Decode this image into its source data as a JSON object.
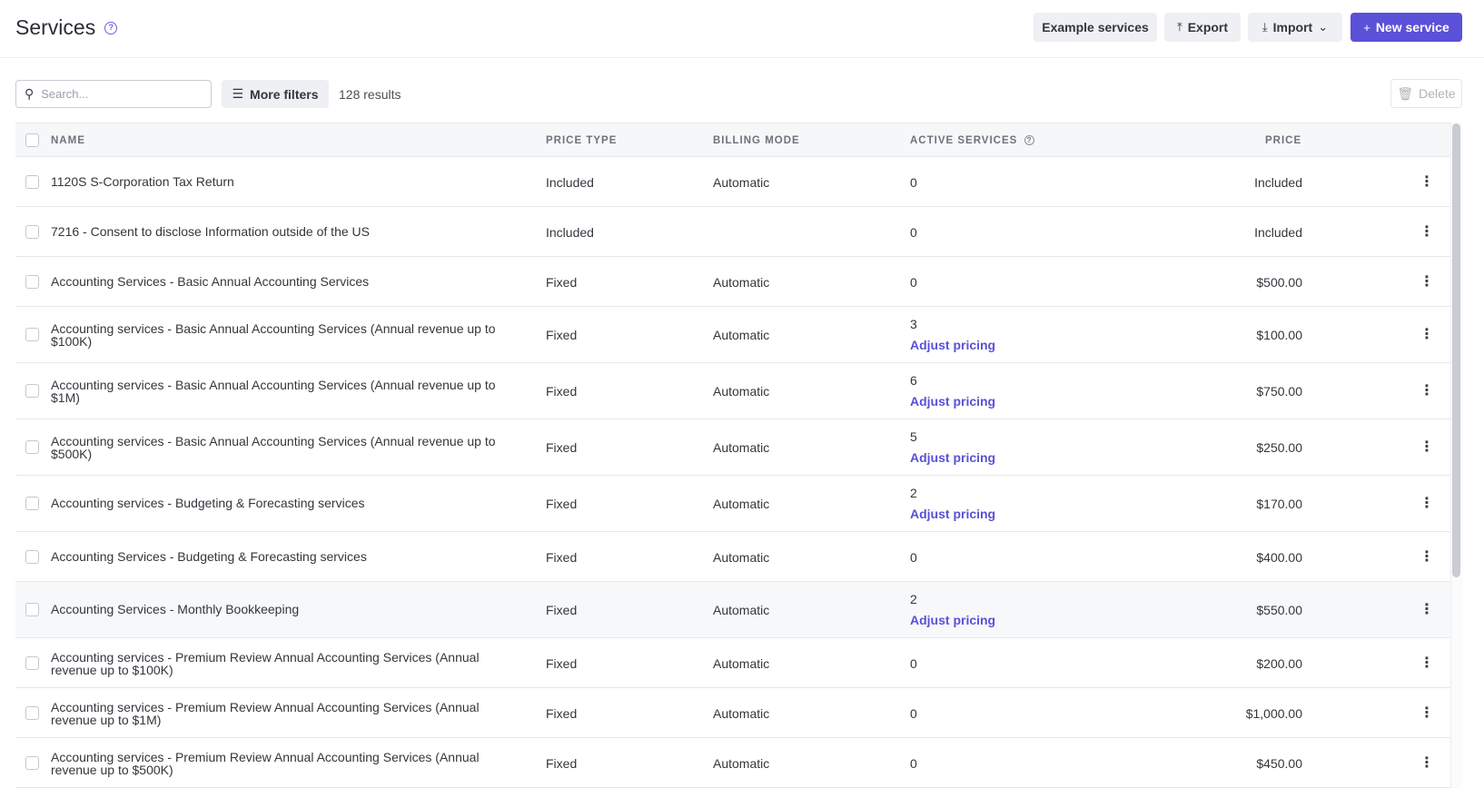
{
  "header": {
    "title": "Services",
    "buttons": {
      "example": "Example services",
      "export": "Export",
      "import": "Import",
      "new_service": "New service"
    }
  },
  "toolbar": {
    "search_placeholder": "Search...",
    "more_filters": "More filters",
    "results": "128 results",
    "delete": "Delete"
  },
  "columns": {
    "name": "NAME",
    "price_type": "PRICE TYPE",
    "billing_mode": "BILLING MODE",
    "active_services": "ACTIVE SERVICES",
    "price": "PRICE"
  },
  "adjust_label": "Adjust pricing",
  "rows": [
    {
      "name": "1120S S-Corporation Tax Return",
      "price_type": "Included",
      "billing_mode": "Automatic",
      "active": "0",
      "adjust": false,
      "price": "Included"
    },
    {
      "name": "7216 - Consent to disclose Information outside of the US",
      "price_type": "Included",
      "billing_mode": "",
      "active": "0",
      "adjust": false,
      "price": "Included"
    },
    {
      "name": "Accounting Services - Basic Annual Accounting Services",
      "price_type": "Fixed",
      "billing_mode": "Automatic",
      "active": "0",
      "adjust": false,
      "price": "$500.00"
    },
    {
      "name": "Accounting services - Basic Annual Accounting Services (Annual revenue up to $100K)",
      "price_type": "Fixed",
      "billing_mode": "Automatic",
      "active": "3",
      "adjust": true,
      "price": "$100.00"
    },
    {
      "name": "Accounting services - Basic Annual Accounting Services (Annual revenue up to $1M)",
      "price_type": "Fixed",
      "billing_mode": "Automatic",
      "active": "6",
      "adjust": true,
      "price": "$750.00"
    },
    {
      "name": "Accounting services - Basic Annual Accounting Services (Annual revenue up to $500K)",
      "price_type": "Fixed",
      "billing_mode": "Automatic",
      "active": "5",
      "adjust": true,
      "price": "$250.00"
    },
    {
      "name": "Accounting services - Budgeting & Forecasting services",
      "price_type": "Fixed",
      "billing_mode": "Automatic",
      "active": "2",
      "adjust": true,
      "price": "$170.00"
    },
    {
      "name": "Accounting Services - Budgeting & Forecasting services",
      "price_type": "Fixed",
      "billing_mode": "Automatic",
      "active": "0",
      "adjust": false,
      "price": "$400.00"
    },
    {
      "name": "Accounting Services - Monthly Bookkeeping",
      "price_type": "Fixed",
      "billing_mode": "Automatic",
      "active": "2",
      "adjust": true,
      "price": "$550.00"
    },
    {
      "name": "Accounting services - Premium Review Annual Accounting Services (Annual revenue up to $100K)",
      "price_type": "Fixed",
      "billing_mode": "Automatic",
      "active": "0",
      "adjust": false,
      "price": "$200.00"
    },
    {
      "name": "Accounting services - Premium Review Annual Accounting Services (Annual revenue up to $1M)",
      "price_type": "Fixed",
      "billing_mode": "Automatic",
      "active": "0",
      "adjust": false,
      "price": "$1,000.00"
    },
    {
      "name": "Accounting services - Premium Review Annual Accounting Services (Annual revenue up to $500K)",
      "price_type": "Fixed",
      "billing_mode": "Automatic",
      "active": "0",
      "adjust": false,
      "price": "$450.00"
    }
  ]
}
